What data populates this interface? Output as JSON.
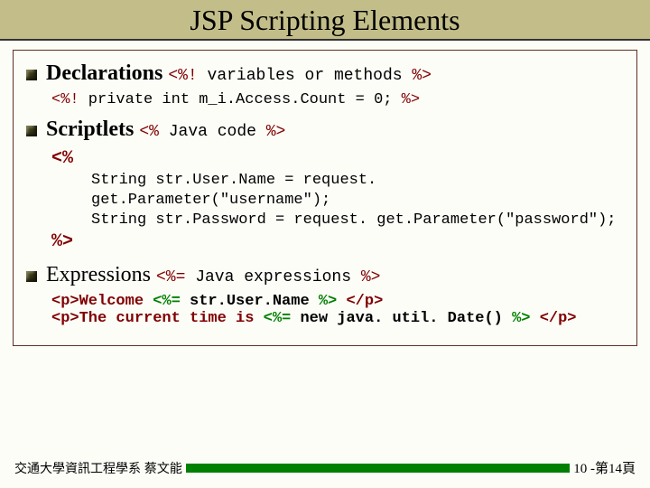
{
  "title": "JSP Scripting Elements",
  "sections": [
    {
      "heading_bold": "Declarations",
      "heading_code_open": "<%!",
      "heading_code_mid": " variables or methods ",
      "heading_code_close": "%>",
      "example_lines": [
        {
          "parts": [
            {
              "cls": "red",
              "t": "<%!"
            },
            {
              "cls": "blk",
              "t": " private int m_i.Access.Count = 0; "
            },
            {
              "cls": "red",
              "t": "%>"
            }
          ]
        }
      ]
    },
    {
      "heading_bold": "Scriptlets",
      "heading_code_open": "<%",
      "heading_code_mid": " Java code ",
      "heading_code_close": "%>",
      "code_block": {
        "open": "<%",
        "body": [
          "String str.User.Name = request. get.Parameter(\"username\");",
          "String str.Password = request. get.Parameter(\"password\");"
        ],
        "close": "%>"
      }
    },
    {
      "heading_plain": "Expressions",
      "heading_code_open": "<%=",
      "heading_code_mid": " Java expressions ",
      "heading_code_close": "%>",
      "example_lines": [
        {
          "parts": [
            {
              "cls": "red",
              "t": "<p>Welcome "
            },
            {
              "cls": "green",
              "t": "<%="
            },
            {
              "cls": "blk",
              "t": " str.User.Name "
            },
            {
              "cls": "green",
              "t": "%>"
            },
            {
              "cls": "red",
              "t": " </p>"
            }
          ]
        },
        {
          "parts": [
            {
              "cls": "red",
              "t": "<p>The current time is "
            },
            {
              "cls": "green",
              "t": "<%="
            },
            {
              "cls": "blk",
              "t": " new java. util. Date() "
            },
            {
              "cls": "green",
              "t": "%>"
            },
            {
              "cls": "red",
              "t": " </p>"
            }
          ]
        }
      ]
    }
  ],
  "footer": {
    "left": "交通大學資訊工程學系 蔡文能",
    "right": "10 -第14頁"
  }
}
